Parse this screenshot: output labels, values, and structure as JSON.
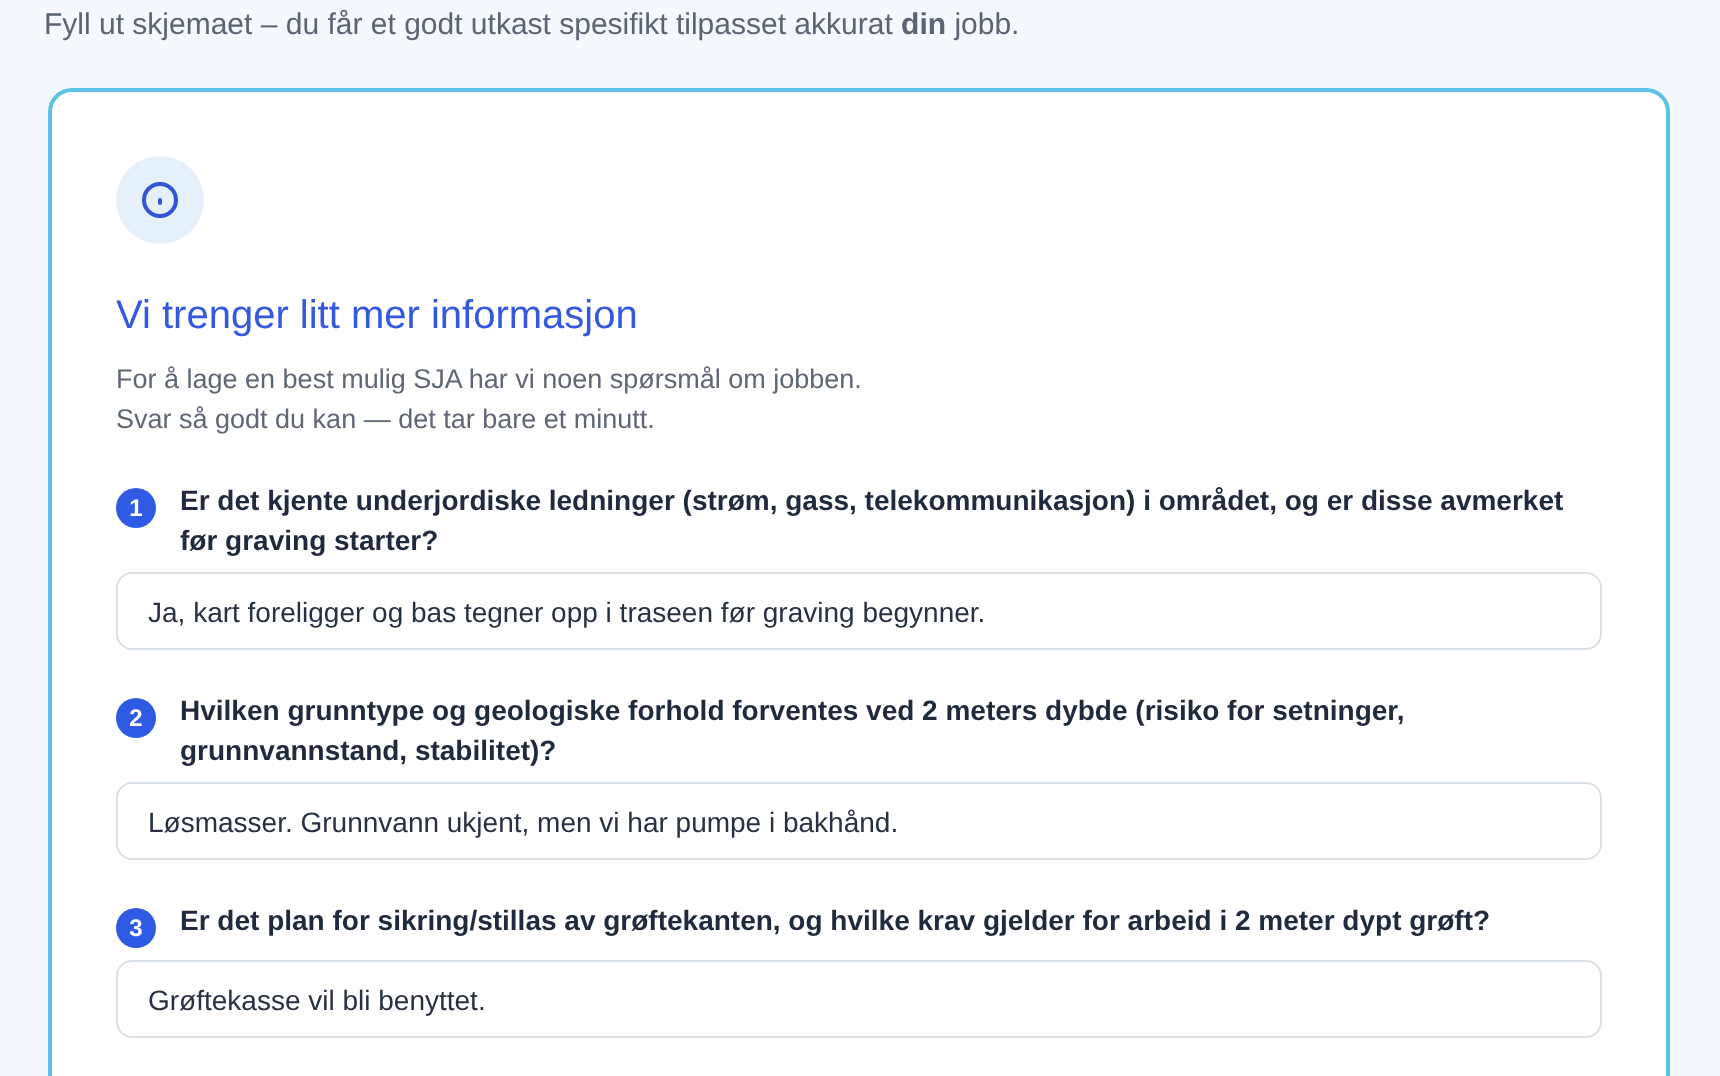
{
  "intro": "Fyll ut skjemaet – du får et godt utkast spesifikt tilpasset akkurat **din** jobb.",
  "card": {
    "title": "Vi trenger litt mer informasjon",
    "description": [
      "For å lage en best mulig SJA har vi noen spørsmål om jobben.",
      "Svar så godt du kan — det tar bare et minutt."
    ],
    "questions": [
      {
        "number": "1",
        "question": "Er det kjente underjordiske ledninger (strøm, gass, telekommunikasjon) i området, og er disse avmerket før graving starter?",
        "answer": "Ja, kart foreligger og bas tegner opp i traseen før graving begynner."
      },
      {
        "number": "2",
        "question": "Hvilken grunntype og geologiske forhold forventes ved 2 meters dybde (risiko for setninger, grunnvannstand, stabilitet)?",
        "answer": "Løsmasser. Grunnvann ukjent, men vi har pumpe i bakhånd."
      },
      {
        "number": "3",
        "question": "Er det plan for sikring/stillas av grøftekanten, og hvilke krav gjelder for arbeid i 2 meter dypt grøft?",
        "answer": "Grøftekasse vil bli benyttet."
      }
    ]
  }
}
